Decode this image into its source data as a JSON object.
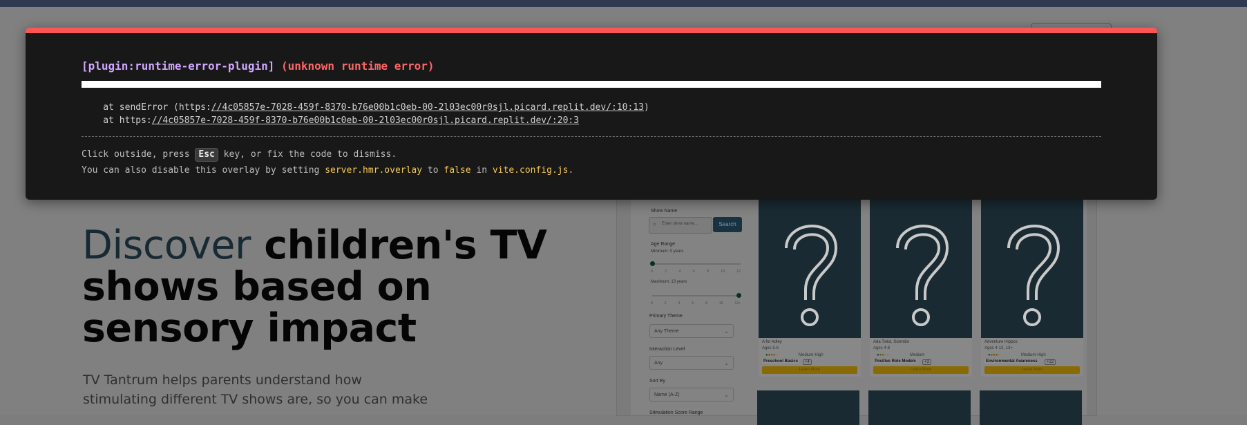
{
  "overlay": {
    "plugin": "[plugin:runtime-error-plugin]",
    "message": "(unknown runtime error)",
    "stack": [
      {
        "prefix": "    at sendError (https:",
        "link": "//4c05857e-7028-459f-8370-b76e00b1c0eb-00-2l03ec00r0sjl.picard.replit.dev/:10:13",
        "suffix": ")"
      },
      {
        "prefix": "    at https:",
        "link": "//4c05857e-7028-459f-8370-b76e00b1c0eb-00-2l03ec00r0sjl.picard.replit.dev/:20:3",
        "suffix": ""
      }
    ],
    "tip_line1_a": "Click outside, press ",
    "tip_key": "Esc",
    "tip_line1_b": " key, or fix the code to dismiss.",
    "tip_line2_a": "You can also disable this overlay by setting ",
    "tip_setting": "server.hmr.overlay",
    "tip_line2_b": " to ",
    "tip_false": "false",
    "tip_line2_c": " in ",
    "tip_file": "vite.config.js",
    "tip_line2_d": "."
  },
  "hero": {
    "title_accent": "Discover",
    "title_rest": " children's TV shows based on sensory impact",
    "description": "TV Tantrum helps parents understand how stimulating different TV shows are, so you can make"
  },
  "filters": {
    "show_name_label": "Show Name",
    "search_placeholder": "Enter show name...",
    "search_button": "Search",
    "age_range_label": "Age Range",
    "minimum_label": "Minimum: 0 years",
    "maximum_label": "Maximum: 13 years",
    "ticks": [
      "0",
      "2",
      "4",
      "6",
      "8",
      "10",
      "12"
    ],
    "ticks_max": [
      "0",
      "2",
      "4",
      "6",
      "8",
      "10",
      "13+"
    ],
    "theme_label": "Primary Theme",
    "theme_value": "Any Theme",
    "interaction_label": "Interaction Level",
    "interaction_value": "Any",
    "sort_label": "Sort By",
    "sort_value": "Name (A-Z)",
    "next_label": "Stimulation Score Range"
  },
  "cards": [
    {
      "name": "A for Adley",
      "age": "Ages 5-8",
      "level": "Medium-High",
      "tag": "Preschool Basics",
      "more": "+4",
      "button": "Learn More"
    },
    {
      "name": "Ada Twist, Scientist",
      "age": "Ages 4-8",
      "level": "Medium",
      "tag": "Positive Role Models",
      "more": "+3",
      "button": "Learn More"
    },
    {
      "name": "Adventure Hippos",
      "age": "Ages 4-13, 13+",
      "level": "Medium-High",
      "tag": "Environmental Awareness",
      "more": "+22",
      "button": "Learn More"
    }
  ],
  "colors": {
    "overlay_border": "#ff5555",
    "plugin_color": "#d0a8ff",
    "error_color": "#ff6666",
    "highlight": "#f5c85a"
  }
}
